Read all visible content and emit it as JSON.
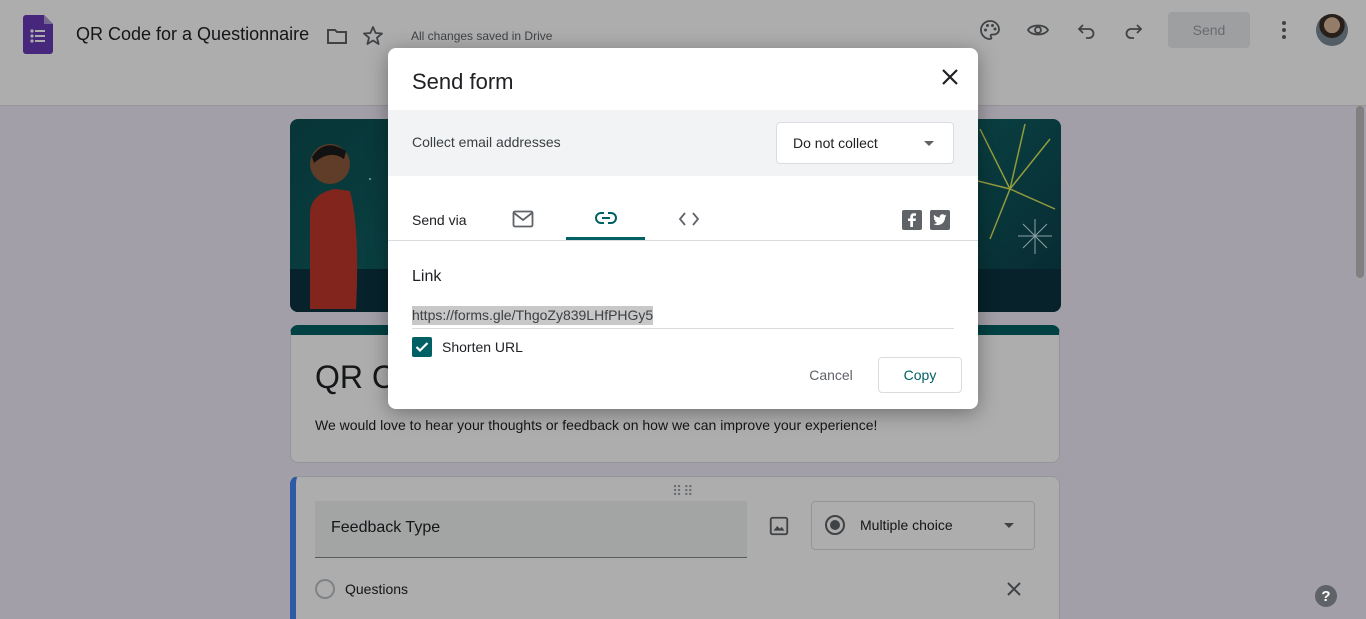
{
  "header": {
    "title": "QR Code for a Questionnaire",
    "save_status": "All changes saved in Drive",
    "send_label": "Send"
  },
  "form": {
    "title_visible": "QR Co",
    "description": "We would love to hear your thoughts or feedback on how we can improve your experience!",
    "question": {
      "title": "Feedback Type",
      "type": "Multiple choice",
      "option_1": "Questions"
    }
  },
  "dialog": {
    "title": "Send form",
    "collect_label": "Collect email addresses",
    "collect_value": "Do not collect",
    "send_via_label": "Send via",
    "link_heading": "Link",
    "link_url": "https://forms.gle/ThgoZy839LHfPHGy5",
    "shorten_label": "Shorten URL",
    "shorten_checked": true,
    "cancel_label": "Cancel",
    "copy_label": "Copy",
    "active_tab": "link"
  },
  "colors": {
    "accent": "#006064",
    "question_accent": "#4285f4",
    "forms_purple": "#673ab7"
  },
  "help_label": "?"
}
